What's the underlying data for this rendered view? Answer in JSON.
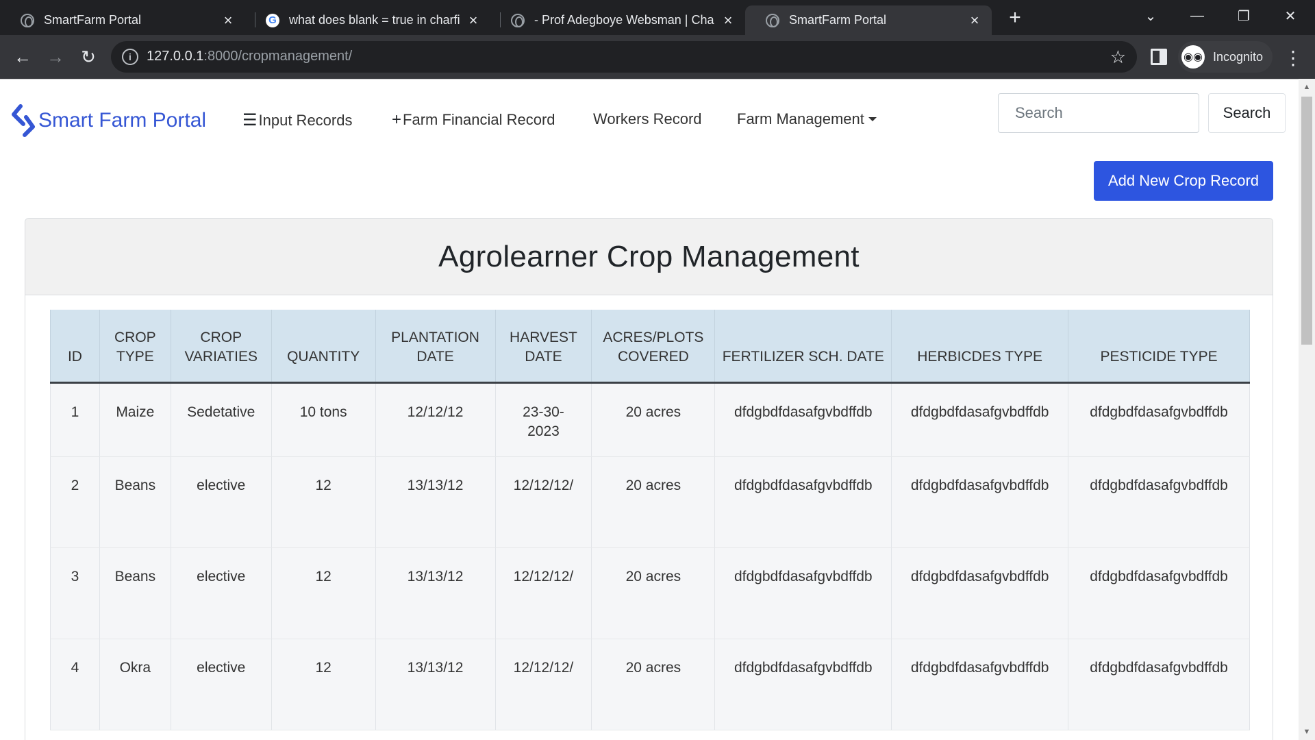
{
  "browser": {
    "tabs": [
      {
        "title": "SmartFarm Portal",
        "icon": "globe-icon"
      },
      {
        "title": "what does blank = true in charfie",
        "icon": "google-icon"
      },
      {
        "title": "- Prof Adegboye Websman | Cha",
        "icon": "globe-icon"
      },
      {
        "title": "SmartFarm Portal",
        "icon": "globe-icon"
      }
    ],
    "url_host": "127.0.0.1",
    "url_path": ":8000/cropmanagement/",
    "profile_label": "Incognito"
  },
  "navbar": {
    "brand": "Smart Farm Portal",
    "links": [
      {
        "label": "Input Records",
        "icon": "list-icon"
      },
      {
        "label": "Farm Financial Record",
        "icon": "plus-icon"
      },
      {
        "label": "Workers Record"
      },
      {
        "label": "Farm Management",
        "icon": "caret-down-icon"
      }
    ],
    "search_placeholder": "Search",
    "search_button": "Search"
  },
  "add_button": "Add New Crop Record",
  "page_title": "Agrolearner Crop Management",
  "table": {
    "headers": [
      "ID",
      "Crop Type",
      "Crop Variaties",
      "Quantity",
      "Plantation Date",
      "Harvest Date",
      "Acres/Plots Covered",
      "Fertilizer Sch. Date",
      "Herbicdes Type",
      "Pesticide Type"
    ],
    "rows": [
      [
        "1",
        "Maize",
        "Sedetative",
        "10 tons",
        "12/12/12",
        "23-30-2023",
        "20 acres",
        "dfdgbdfdasafgvbdffdb",
        "dfdgbdfdasafgvbdffdb",
        "dfdgbdfdasafgvbdffdb"
      ],
      [
        "2",
        "Beans",
        "elective",
        "12",
        "13/13/12",
        "12/12/12/",
        "20 acres",
        "dfdgbdfdasafgvbdffdb",
        "dfdgbdfdasafgvbdffdb",
        "dfdgbdfdasafgvbdffdb"
      ],
      [
        "3",
        "Beans",
        "elective",
        "12",
        "13/13/12",
        "12/12/12/",
        "20 acres",
        "dfdgbdfdasafgvbdffdb",
        "dfdgbdfdasafgvbdffdb",
        "dfdgbdfdasafgvbdffdb"
      ],
      [
        "4",
        "Okra",
        "elective",
        "12",
        "13/13/12",
        "12/12/12/",
        "20 acres",
        "dfdgbdfdasafgvbdffdb",
        "dfdgbdfdasafgvbdffdb",
        "dfdgbdfdasafgvbdffdb"
      ]
    ]
  },
  "colors": {
    "brand": "#3556d4",
    "primary_button": "#2d55e0",
    "table_header": "#d3e3ee",
    "chrome_dark": "#202124"
  }
}
